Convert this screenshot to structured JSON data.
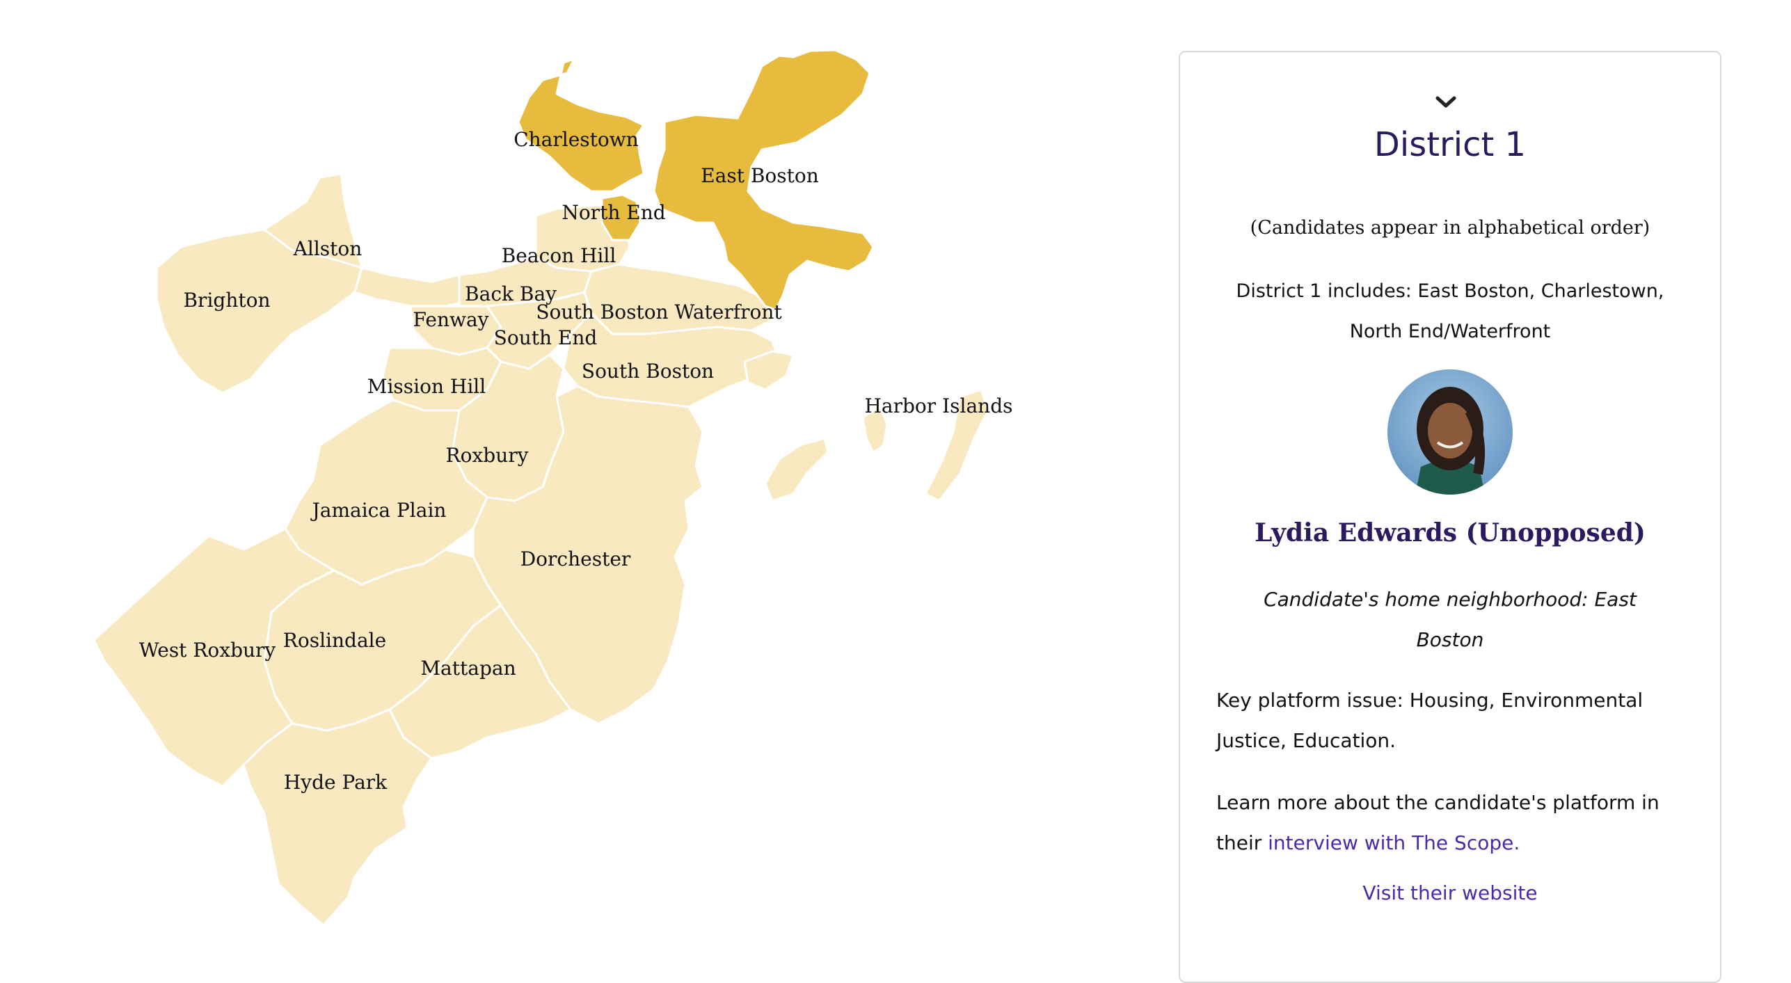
{
  "map": {
    "colors": {
      "selected": "#e6bb3e",
      "unselected": "#f8e9c1",
      "border": "#ffffff"
    },
    "selected_district": "District 1",
    "neighborhoods": [
      {
        "id": "charlestown",
        "label": "Charlestown",
        "selected": true
      },
      {
        "id": "east-boston",
        "label": "East Boston",
        "selected": true
      },
      {
        "id": "north-end",
        "label": "North End",
        "selected": true
      },
      {
        "id": "beacon-hill",
        "label": "Beacon Hill",
        "selected": false
      },
      {
        "id": "allston",
        "label": "Allston",
        "selected": false
      },
      {
        "id": "brighton",
        "label": "Brighton",
        "selected": false
      },
      {
        "id": "back-bay",
        "label": "Back Bay",
        "selected": false
      },
      {
        "id": "south-boston-waterfront",
        "label": "South Boston Waterfront",
        "selected": false
      },
      {
        "id": "fenway",
        "label": "Fenway",
        "selected": false
      },
      {
        "id": "south-end",
        "label": "South End",
        "selected": false
      },
      {
        "id": "south-boston",
        "label": "South Boston",
        "selected": false
      },
      {
        "id": "mission-hill",
        "label": "Mission Hill",
        "selected": false
      },
      {
        "id": "harbor-islands",
        "label": "Harbor Islands",
        "selected": false
      },
      {
        "id": "roxbury",
        "label": "Roxbury",
        "selected": false
      },
      {
        "id": "jamaica-plain",
        "label": "Jamaica Plain",
        "selected": false
      },
      {
        "id": "dorchester",
        "label": "Dorchester",
        "selected": false
      },
      {
        "id": "roslindale",
        "label": "Roslindale",
        "selected": false
      },
      {
        "id": "west-roxbury",
        "label": "West Roxbury",
        "selected": false
      },
      {
        "id": "mattapan",
        "label": "Mattapan",
        "selected": false
      },
      {
        "id": "hyde-park",
        "label": "Hyde Park",
        "selected": false
      }
    ]
  },
  "panel": {
    "chevron_icon": "chevron-down-icon",
    "title": "District 1",
    "order_note": "(Candidates appear in alphabetical order)",
    "includes": "District 1 includes: East Boston, Charlestown, North End/Waterfront",
    "avatar_icon": "candidate-portrait",
    "candidate_name": "Lydia Edwards (Unopposed)",
    "home_neighborhood": "Candidate's home neighborhood: East Boston",
    "platform": "Key platform issue: Housing, Environmental Justice, Education.",
    "learn_more_prefix": "Learn more about the candidate's platform in their ",
    "interview_link": "interview with The Scope.",
    "website_link": "Visit their website"
  }
}
